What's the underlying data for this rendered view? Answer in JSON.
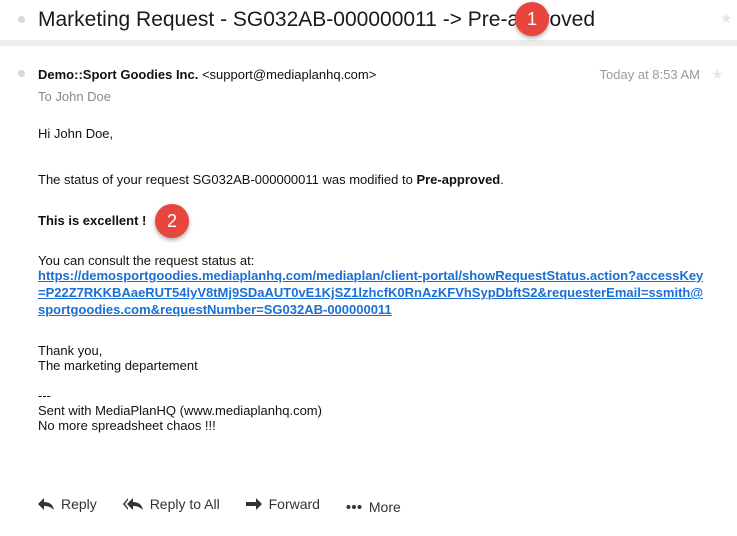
{
  "subject": {
    "title": "Marketing Request - SG032AB-000000011 -> Pre-approved",
    "badge": "1"
  },
  "header": {
    "sender_name": "Demo::Sport Goodies Inc.",
    "sender_email": "<support@mediaplanhq.com>",
    "to_label": "To",
    "to_name": "John Doe",
    "timestamp": "Today at 8:53 AM"
  },
  "body": {
    "greeting": "Hi John Doe,",
    "status_prefix": "The status of your request SG032AB-000000011 was modified to ",
    "status_value": "Pre-approved",
    "status_suffix": ".",
    "excellent": "This is excellent !",
    "badge": "2",
    "consult": "You can consult the request status at:",
    "link": "https://demosportgoodies.mediaplanhq.com/mediaplan/client-portal/showRequestStatus.action?accessKey=P22Z7RKKBAaeRUT54lyV8tMj9SDaAUT0vE1KjSZ1lzhcfK0RnAzKFVhSypDbftS2&requesterEmail=ssmith@sportgoodies.com&requestNumber=SG032AB-000000011",
    "thanks": "Thank you,",
    "signature": "The marketing departement",
    "separator": "---",
    "sent_with": "Sent with MediaPlanHQ (www.mediaplanhq.com)",
    "tagline": "No more spreadsheet chaos !!!"
  },
  "actions": {
    "reply": "Reply",
    "reply_all": "Reply to All",
    "forward": "Forward",
    "more": "More"
  },
  "icons": {
    "reply": "reply-arrow-icon",
    "reply_all": "reply-all-arrow-icon",
    "forward": "forward-arrow-icon",
    "more": "more-dots-icon",
    "star": "star-icon"
  },
  "colors": {
    "link": "#1a6fd6",
    "badge": "#e8453c"
  }
}
